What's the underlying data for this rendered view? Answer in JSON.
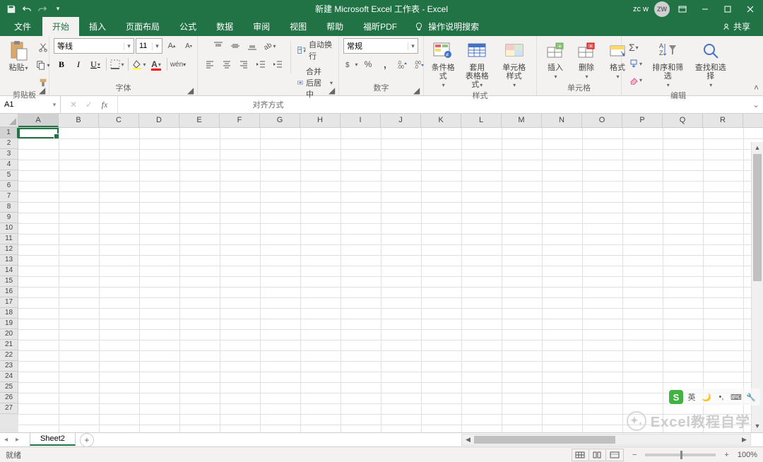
{
  "title": "新建 Microsoft Excel 工作表  -  Excel",
  "user": {
    "name": "zc w",
    "initials": "ZW"
  },
  "tabs": {
    "file": "文件",
    "home": "开始",
    "insert": "插入",
    "layout": "页面布局",
    "formulas": "公式",
    "data": "数据",
    "review": "审阅",
    "view": "视图",
    "help": "帮助",
    "foxit": "福昕PDF",
    "tellme": "操作说明搜索",
    "share": "共享"
  },
  "ribbon": {
    "clipboard": {
      "paste": "粘贴",
      "label": "剪贴板"
    },
    "font": {
      "name": "等线",
      "size": "11",
      "label": "字体"
    },
    "alignment": {
      "wrap": "自动换行",
      "merge": "合并后居中",
      "label": "对齐方式"
    },
    "number": {
      "format": "常规",
      "label": "数字"
    },
    "styles": {
      "conditional": "条件格式",
      "table": "套用\n表格格式",
      "cell": "单元格样式",
      "label": "样式"
    },
    "cells": {
      "insert": "插入",
      "delete": "删除",
      "format": "格式",
      "label": "单元格"
    },
    "editing": {
      "sort": "排序和筛选",
      "find": "查找和选择",
      "label": "编辑"
    }
  },
  "namebox": "A1",
  "formula": "",
  "columns": [
    "A",
    "B",
    "C",
    "D",
    "E",
    "F",
    "G",
    "H",
    "I",
    "J",
    "K",
    "L",
    "M",
    "N",
    "O",
    "P",
    "Q",
    "R"
  ],
  "rows": [
    1,
    2,
    3,
    4,
    5,
    6,
    7,
    8,
    9,
    10,
    11,
    12,
    13,
    14,
    15,
    16,
    17,
    18,
    19,
    20,
    21,
    22,
    23,
    24,
    25,
    26,
    27
  ],
  "sheet": {
    "active": "Sheet2"
  },
  "status": {
    "ready": "就绪",
    "zoom": "100%"
  },
  "ime": {
    "lang": "英"
  },
  "watermark": "Excel教程自学"
}
